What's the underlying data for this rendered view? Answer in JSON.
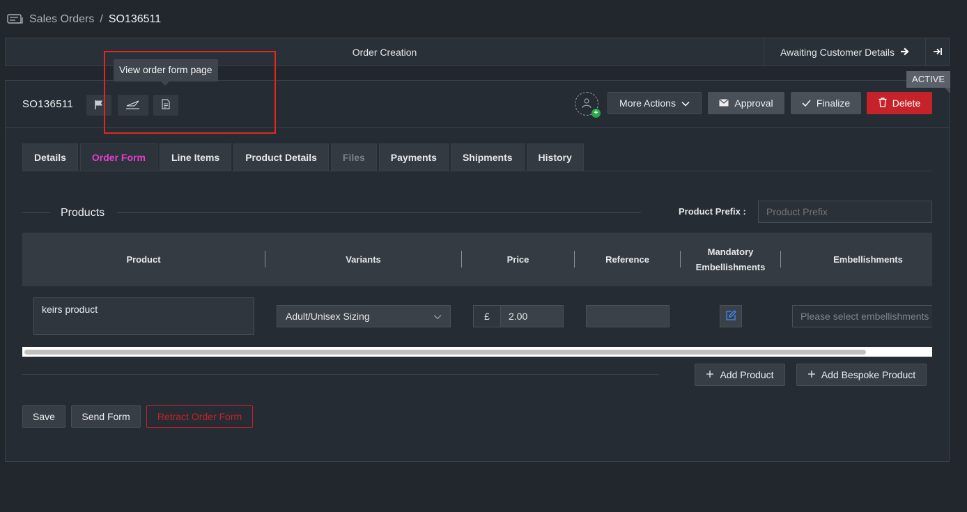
{
  "breadcrumb": {
    "parent": "Sales Orders",
    "separator": "/",
    "current": "SO136511"
  },
  "status_bar": {
    "current_stage": "Order Creation",
    "next_stage": "Awaiting Customer Details"
  },
  "order": {
    "id": "SO136511",
    "status_badge": "ACTIVE"
  },
  "tooltip": {
    "text": "View order form page"
  },
  "actions": {
    "more_actions": "More Actions",
    "approval": "Approval",
    "finalize": "Finalize",
    "delete": "Delete"
  },
  "tabs": [
    {
      "label": "Details",
      "state": "normal"
    },
    {
      "label": "Order Form",
      "state": "active"
    },
    {
      "label": "Line Items",
      "state": "normal"
    },
    {
      "label": "Product Details",
      "state": "normal"
    },
    {
      "label": "Files",
      "state": "disabled"
    },
    {
      "label": "Payments",
      "state": "normal"
    },
    {
      "label": "Shipments",
      "state": "normal"
    },
    {
      "label": "History",
      "state": "normal"
    }
  ],
  "products_section": {
    "title": "Products",
    "prefix_label": "Product Prefix :",
    "prefix_placeholder": "Product Prefix"
  },
  "table": {
    "columns": [
      "Product",
      "Variants",
      "Price",
      "Reference",
      "Mandatory Embellishments",
      "Embellishments"
    ],
    "rows": [
      {
        "product": "keirs product",
        "variant": "Adult/Unisex Sizing",
        "currency": "£",
        "price": "2.00",
        "reference": "",
        "embellishments_placeholder": "Please select embellishments"
      }
    ]
  },
  "buttons": {
    "add_product": "Add Product",
    "add_bespoke_product": "Add Bespoke Product",
    "save": "Save",
    "send_form": "Send Form",
    "retract_order_form": "Retract Order Form"
  },
  "colors": {
    "background": "#22272d",
    "accent_tab": "#e63ed0",
    "delete": "#c62229",
    "highlight": "#e0281c"
  }
}
